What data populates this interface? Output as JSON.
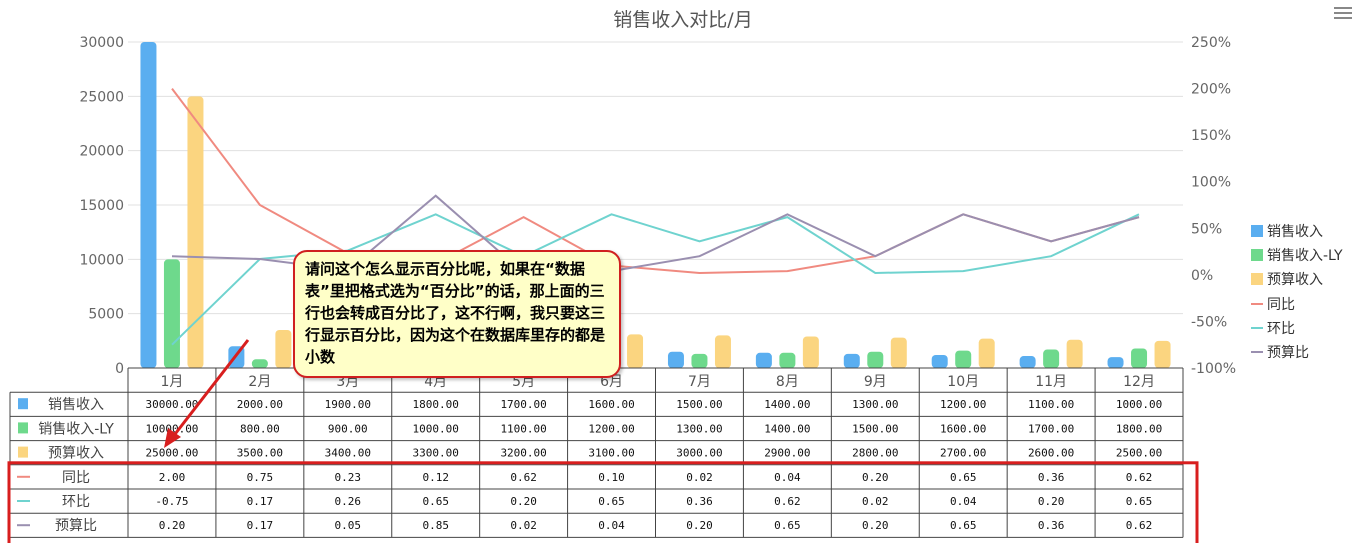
{
  "chart_data": {
    "type": "bar",
    "title": "销售收入对比/月",
    "categories": [
      "1月",
      "2月",
      "3月",
      "4月",
      "5月",
      "6月",
      "7月",
      "8月",
      "9月",
      "10月",
      "11月",
      "12月"
    ],
    "y_left": {
      "min": 0,
      "max": 30000,
      "ticks": [
        "0",
        "5000",
        "10000",
        "15000",
        "20000",
        "25000",
        "30000"
      ]
    },
    "y_right": {
      "min": -100,
      "max": 250,
      "ticks": [
        "-100%",
        "-50%",
        "0%",
        "50%",
        "100%",
        "150%",
        "200%",
        "250%"
      ]
    },
    "bar_series": [
      {
        "name": "销售收入",
        "color": "#5aaef0",
        "values": [
          30000,
          2000,
          1900,
          1800,
          1700,
          1600,
          1500,
          1400,
          1300,
          1200,
          1100,
          1000
        ],
        "labels": [
          "30000.00",
          "2000.00",
          "1900.00",
          "1800.00",
          "1700.00",
          "1600.00",
          "1500.00",
          "1400.00",
          "1300.00",
          "1200.00",
          "1100.00",
          "1000.00"
        ]
      },
      {
        "name": "销售收入-LY",
        "color": "#6ed98c",
        "values": [
          10000,
          800,
          900,
          1000,
          1100,
          1200,
          1300,
          1400,
          1500,
          1600,
          1700,
          1800
        ],
        "labels": [
          "10000.00",
          "800.00",
          "900.00",
          "1000.00",
          "1100.00",
          "1200.00",
          "1300.00",
          "1400.00",
          "1500.00",
          "1600.00",
          "1700.00",
          "1800.00"
        ]
      },
      {
        "name": "预算收入",
        "color": "#fbd580",
        "values": [
          25000,
          3500,
          3400,
          3300,
          3200,
          3100,
          3000,
          2900,
          2800,
          2700,
          2600,
          2500
        ],
        "labels": [
          "25000.00",
          "3500.00",
          "3400.00",
          "3300.00",
          "3200.00",
          "3100.00",
          "3000.00",
          "2900.00",
          "2800.00",
          "2700.00",
          "2600.00",
          "2500.00"
        ]
      }
    ],
    "line_series": [
      {
        "name": "同比",
        "color": "#f08a80",
        "values": [
          2.0,
          0.75,
          0.23,
          0.12,
          0.62,
          0.1,
          0.02,
          0.04,
          0.2,
          0.65,
          0.36,
          0.62
        ],
        "labels": [
          "2.00",
          "0.75",
          "0.23",
          "0.12",
          "0.62",
          "0.10",
          "0.02",
          "0.04",
          "0.20",
          "0.65",
          "0.36",
          "0.62"
        ]
      },
      {
        "name": "环比",
        "color": "#6fd3cf",
        "values": [
          -0.75,
          0.17,
          0.26,
          0.65,
          0.2,
          0.65,
          0.36,
          0.62,
          0.02,
          0.04,
          0.2,
          0.65
        ],
        "labels": [
          "-0.75",
          "0.17",
          "0.26",
          "0.65",
          "0.20",
          "0.65",
          "0.36",
          "0.62",
          "0.02",
          "0.04",
          "0.20",
          "0.65"
        ]
      },
      {
        "name": "预算比",
        "color": "#9a8fb0",
        "values": [
          0.2,
          0.17,
          0.05,
          0.85,
          0.02,
          0.04,
          0.2,
          0.65,
          0.2,
          0.65,
          0.36,
          0.62
        ],
        "labels": [
          "0.20",
          "0.17",
          "0.05",
          "0.85",
          "0.02",
          "0.04",
          "0.20",
          "0.65",
          "0.20",
          "0.65",
          "0.36",
          "0.62"
        ]
      }
    ],
    "grid": true,
    "legend_position": "right"
  },
  "callout": {
    "text": "请问这个怎么显示百分比呢，如果在“数据表”里把格式选为“百分比”的话，那上面的三行也会转成百分比了，这不行啊，我只要这三行显示百分比，因为这个在数据库里存的都是小数"
  },
  "colors": {
    "annotation_red": "#d81e1e",
    "grid": "#e0e0e0",
    "axis_text": "#666666"
  },
  "icons": {
    "menu": "hamburger-menu-icon"
  }
}
